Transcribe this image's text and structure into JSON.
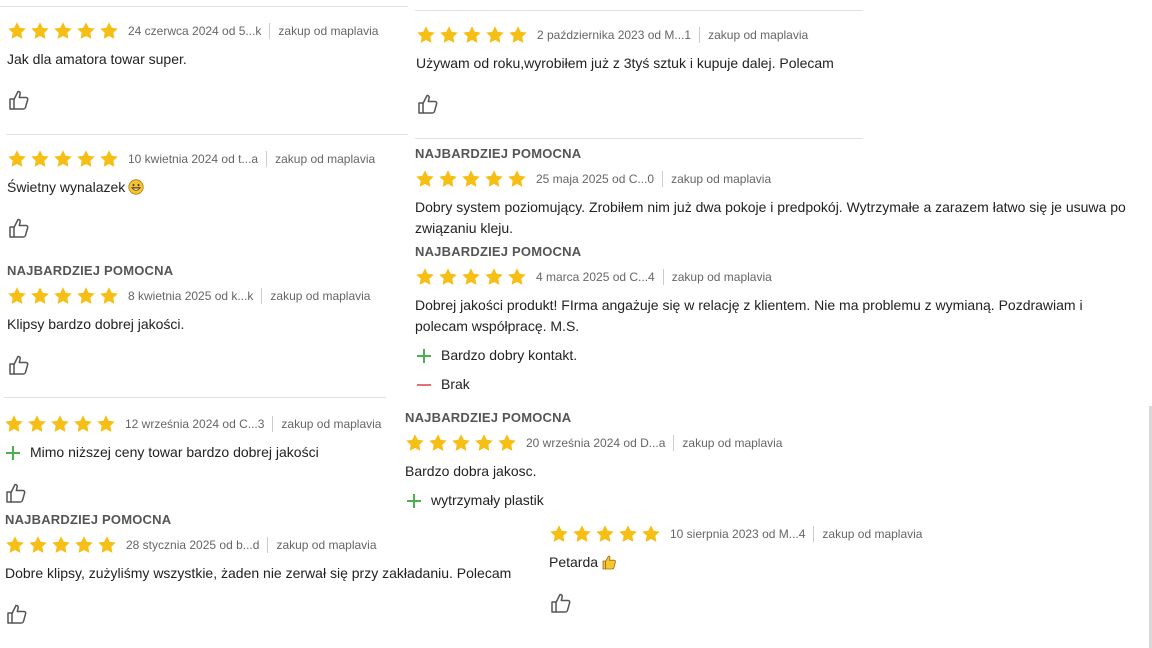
{
  "colors": {
    "star": "#f5bf16",
    "plus": "#4caf50",
    "minus": "#e57373",
    "icon": "#555555",
    "divider": "#e2e2e2"
  },
  "reviews": [
    {
      "date": "24 czerwca 2024 od 5...k",
      "source": "zakup od maplavia",
      "text": "Jak dla amatora towar super."
    },
    {
      "date": "2 października 2023 od M...1",
      "source": "zakup od maplavia",
      "text": "Używam od roku,wyrobiłem już z 3tyś sztuk i kupuje dalej. Polecam"
    },
    {
      "date": "10 kwietnia 2024 od t...a",
      "source": "zakup od maplavia",
      "text": "Świetny wynalazek"
    },
    {
      "badge": "NAJBARDZIEJ POMOCNA",
      "date": "25 maja 2025 od C...0",
      "source": "zakup od maplavia",
      "text": "Dobry system poziomujący. Zrobiłem nim już dwa pokoje i predpokój. Wytrzymałe a zarazem łatwo się je usuwa po związaniu kleju."
    },
    {
      "badge": "NAJBARDZIEJ POMOCNA",
      "date": "8 kwietnia 2025 od k...k",
      "source": "zakup od maplavia",
      "text": "Klipsy bardzo dobrej jakości."
    },
    {
      "badge": "NAJBARDZIEJ POMOCNA",
      "date": "4 marca 2025 od C...4",
      "source": "zakup od maplavia",
      "text": "Dobrej jakości produkt! FIrma angażuje się w relację z klientem. Nie ma problemu z wymianą. Pozdrawiam i polecam współpracę. M.S.",
      "pro": "Bardzo dobry kontakt.",
      "con": "Brak"
    },
    {
      "date": "12 września 2024 od C...3",
      "source": "zakup od maplavia",
      "pro": "Mimo niższej ceny towar bardzo dobrej jakości"
    },
    {
      "badge": "NAJBARDZIEJ POMOCNA",
      "date": "20 września 2024 od D...a",
      "source": "zakup od maplavia",
      "text": "Bardzo dobra jakosc.",
      "pro": "wytrzymały plastik"
    },
    {
      "badge": "NAJBARDZIEJ POMOCNA",
      "date": "28 stycznia 2025 od b...d",
      "source": "zakup od maplavia",
      "text": "Dobre klipsy, zużyliśmy wszystkie, żaden nie zerwał się przy zakładaniu. Polecam"
    },
    {
      "date": "10 sierpnia 2023 od M...4",
      "source": "zakup od maplavia",
      "text": "Petarda"
    }
  ]
}
